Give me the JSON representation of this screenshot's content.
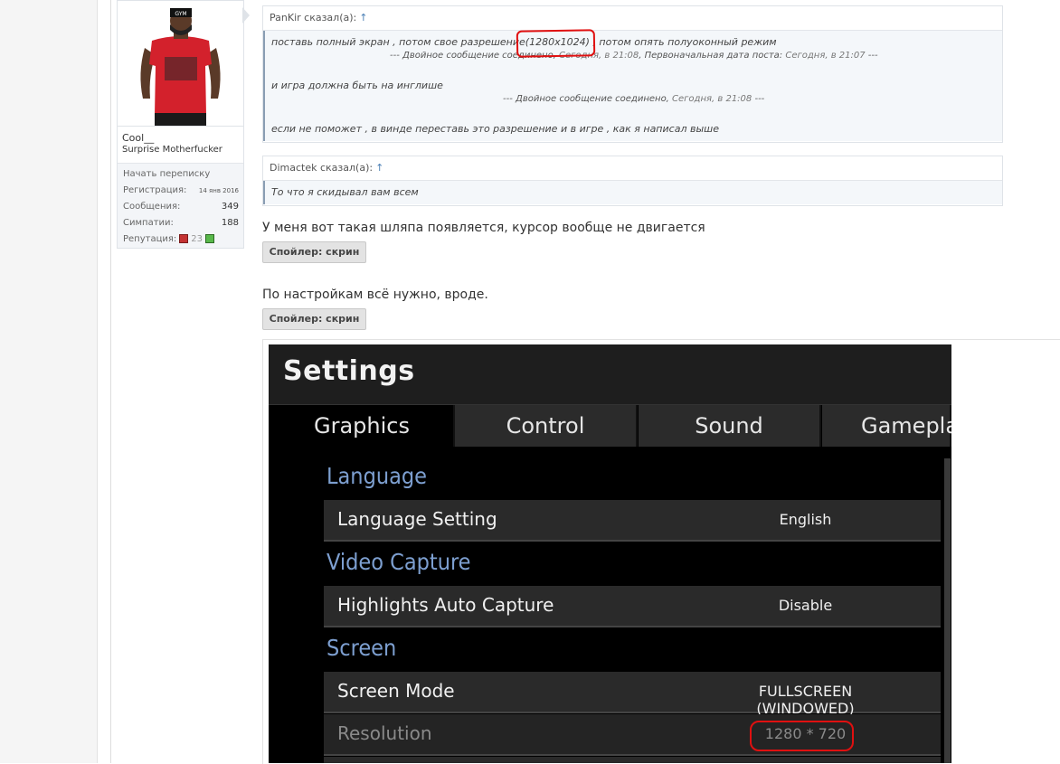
{
  "user": {
    "name": "Cool__",
    "title": "Surprise Motherfucker",
    "pm_link": "Начать переписку",
    "stats": [
      {
        "label": "Регистрация:",
        "value": "14 янв 2016"
      },
      {
        "label": "Сообщения:",
        "value": "349"
      },
      {
        "label": "Симпатии:",
        "value": "188"
      }
    ],
    "reputation_label": "Репутация:",
    "reputation_value": "23",
    "avatar_text": "GYM"
  },
  "quote1": {
    "author": "PanKir сказал(а):",
    "arrow": "↑",
    "line1_before": "поставь полный экран , потом свое разрешение",
    "line1_highlight": "(1280x1024)",
    "line1_after": " , потом опять полуоконный режим",
    "merge1_prefix": "--- Двойное сообщение соединено, ",
    "merge1_date": "Сегодня, в 21:08",
    "merge1_mid": ", Первоначальная дата поста: ",
    "merge1_date2": "Сегодня, в 21:07",
    "merge1_suffix": " ---",
    "line2": "и игра должна быть на инглише",
    "merge2_prefix": "--- Двойное сообщение соединено, ",
    "merge2_date": "Сегодня, в 21:08",
    "merge2_suffix": " ---",
    "line3": "если не поможет , в винде переставь это разрешение и в игре , как я написал выше"
  },
  "quote2": {
    "author": "Dimactek сказал(а):",
    "arrow": "↑",
    "text": "То что я скидывал вам всем"
  },
  "post": {
    "text1": "У меня вот такая шляпа появляется, курсор вообще не двигается",
    "spoiler1": "Спойлер: скрин",
    "text2": "По настройкам всё нужно, вроде.",
    "spoiler2": "Спойлер: скрин"
  },
  "game": {
    "title": "Settings",
    "tabs": [
      "Graphics",
      "Control",
      "Sound",
      "Gamepla"
    ],
    "sections": [
      {
        "title": "Language",
        "rows": [
          {
            "label": "Language Setting",
            "value": "English"
          }
        ]
      },
      {
        "title": "Video Capture",
        "rows": [
          {
            "label": "Highlights Auto Capture",
            "value": "Disable"
          }
        ]
      },
      {
        "title": "Screen",
        "rows": [
          {
            "label": "Screen Mode",
            "value": "FULLSCREEN (WINDOWED)"
          },
          {
            "label": "Resolution",
            "value": "1280 * 720"
          }
        ]
      }
    ]
  },
  "colors": {
    "annotation": "#e01010",
    "section_title": "#7d9fd0",
    "quote_arrow": "#4a7fb5"
  }
}
